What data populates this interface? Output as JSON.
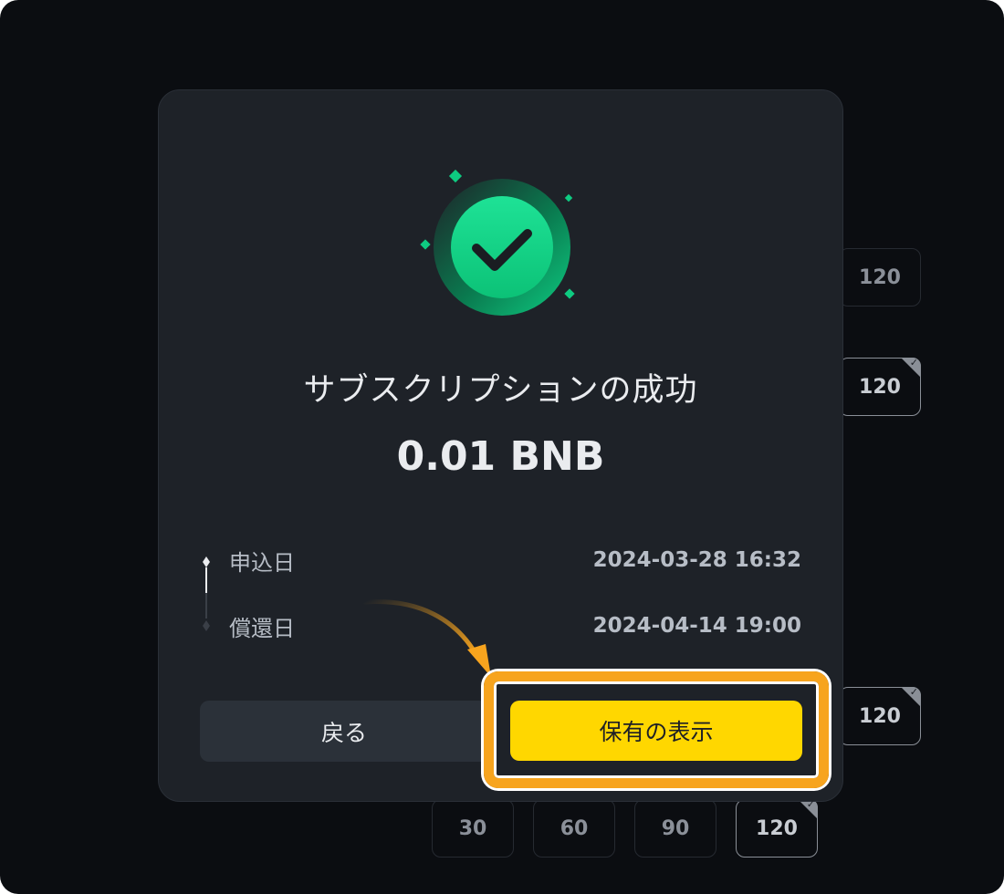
{
  "modal": {
    "title": "サブスクリプションの成功",
    "amount": "0.01 BNB",
    "rows": [
      {
        "label": "申込日",
        "value": "2024-03-28 16:32"
      },
      {
        "label": "償還日",
        "value": "2024-04-14 19:00"
      }
    ],
    "back_label": "戻る",
    "view_label": "保有の表示"
  },
  "background_chips": {
    "right_1": "120",
    "right_2": "120",
    "right_3": "120",
    "bottom": [
      "30",
      "60",
      "90",
      "120"
    ]
  },
  "colors": {
    "background": "#0b0d11",
    "modal": "#1e2228",
    "accent_yellow": "#ffd700",
    "highlight_orange": "#f7a41e",
    "success_green": "#0ecb81"
  },
  "icons": {
    "success": "check-circle-icon",
    "timeline": "timeline-icon",
    "pointer": "curved-arrow-icon"
  }
}
